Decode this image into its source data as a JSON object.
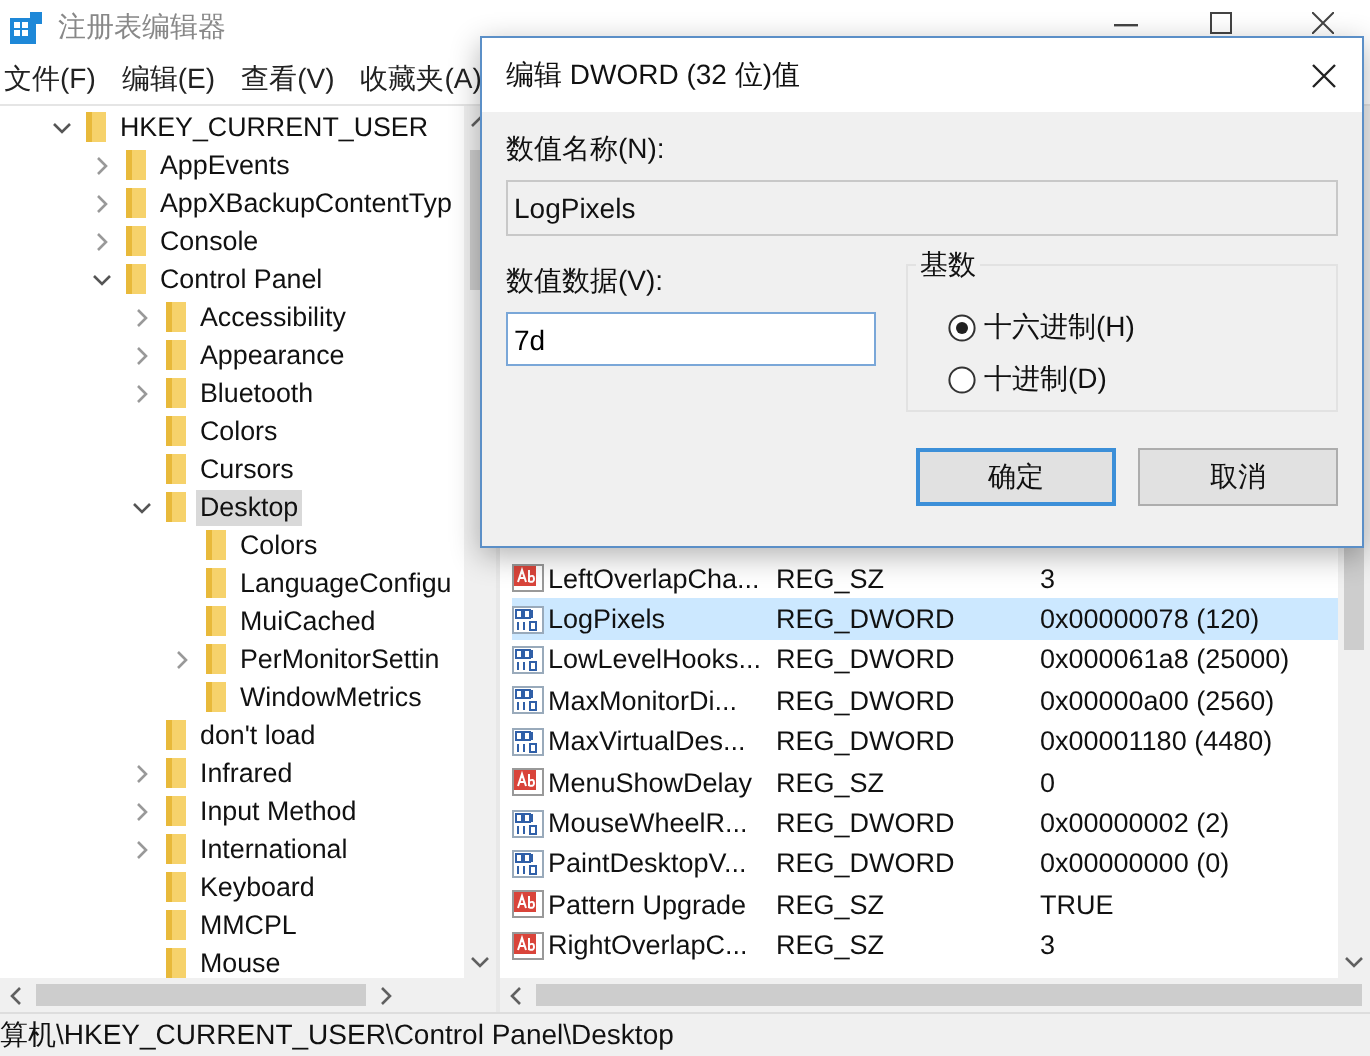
{
  "window": {
    "title": "注册表编辑器"
  },
  "menu": [
    "文件(F)",
    "编辑(E)",
    "查看(V)",
    "收藏夹(A)"
  ],
  "tree": [
    {
      "label": "HKEY_CURRENT_USER",
      "kind": "open",
      "selected": false,
      "children": [
        {
          "label": "AppEvents",
          "kind": "closed",
          "selected": false
        },
        {
          "label": "AppXBackupContentTyp",
          "kind": "closed",
          "selected": false
        },
        {
          "label": "Console",
          "kind": "closed",
          "selected": false
        },
        {
          "label": "Control Panel",
          "kind": "open",
          "selected": false,
          "children": [
            {
              "label": "Accessibility",
              "kind": "closed",
              "selected": false
            },
            {
              "label": "Appearance",
              "kind": "closed",
              "selected": false
            },
            {
              "label": "Bluetooth",
              "kind": "closed",
              "selected": false
            },
            {
              "label": "Colors",
              "kind": "leaf",
              "selected": false
            },
            {
              "label": "Cursors",
              "kind": "leaf",
              "selected": false
            },
            {
              "label": "Desktop",
              "kind": "open",
              "selected": true,
              "children": [
                {
                  "label": "Colors",
                  "kind": "leaf",
                  "selected": false
                },
                {
                  "label": "LanguageConfigu",
                  "kind": "leaf",
                  "selected": false
                },
                {
                  "label": "MuiCached",
                  "kind": "leaf",
                  "selected": false
                },
                {
                  "label": "PerMonitorSettin",
                  "kind": "closed",
                  "selected": false
                },
                {
                  "label": "WindowMetrics",
                  "kind": "leaf",
                  "selected": false
                }
              ]
            },
            {
              "label": "don't load",
              "kind": "leaf",
              "selected": false
            },
            {
              "label": "Infrared",
              "kind": "closed",
              "selected": false
            },
            {
              "label": "Input Method",
              "kind": "closed",
              "selected": false
            },
            {
              "label": "International",
              "kind": "closed",
              "selected": false
            },
            {
              "label": "Keyboard",
              "kind": "leaf",
              "selected": false
            },
            {
              "label": "MMCPL",
              "kind": "leaf",
              "selected": false
            },
            {
              "label": "Mouse",
              "kind": "leaf",
              "selected": false
            }
          ]
        }
      ]
    }
  ],
  "values": [
    {
      "kind": "string",
      "name": "LeftOverlapCha...",
      "type": "REG_SZ",
      "data": "3",
      "selected": false
    },
    {
      "kind": "dword",
      "name": "LogPixels",
      "type": "REG_DWORD",
      "data": "0x00000078 (120)",
      "selected": true
    },
    {
      "kind": "dword",
      "name": "LowLevelHooks...",
      "type": "REG_DWORD",
      "data": "0x000061a8 (25000)",
      "selected": false
    },
    {
      "kind": "dword",
      "name": "MaxMonitorDi...",
      "type": "REG_DWORD",
      "data": "0x00000a00 (2560)",
      "selected": false
    },
    {
      "kind": "dword",
      "name": "MaxVirtualDes...",
      "type": "REG_DWORD",
      "data": "0x00001180 (4480)",
      "selected": false
    },
    {
      "kind": "string",
      "name": "MenuShowDelay",
      "type": "REG_SZ",
      "data": "0",
      "selected": false
    },
    {
      "kind": "dword",
      "name": "MouseWheelR...",
      "type": "REG_DWORD",
      "data": "0x00000002 (2)",
      "selected": false
    },
    {
      "kind": "dword",
      "name": "PaintDesktopV...",
      "type": "REG_DWORD",
      "data": "0x00000000 (0)",
      "selected": false
    },
    {
      "kind": "string",
      "name": "Pattern Upgrade",
      "type": "REG_SZ",
      "data": "TRUE",
      "selected": false
    },
    {
      "kind": "string",
      "name": "RightOverlapC...",
      "type": "REG_SZ",
      "data": "3",
      "selected": false
    }
  ],
  "status_bar": "算机\\HKEY_CURRENT_USER\\Control Panel\\Desktop",
  "dialog": {
    "title": "编辑 DWORD (32 位)值",
    "name_label": "数值名称(N):",
    "name_value": "LogPixels",
    "data_label": "数值数据(V):",
    "data_value": "7d",
    "base_label": "基数",
    "bases": [
      {
        "label": "十六进制(H)",
        "selected": true
      },
      {
        "label": "十进制(D)",
        "selected": false
      }
    ],
    "buttons": [
      {
        "label": "确定",
        "focused": true
      },
      {
        "label": "取消",
        "focused": false
      }
    ]
  }
}
